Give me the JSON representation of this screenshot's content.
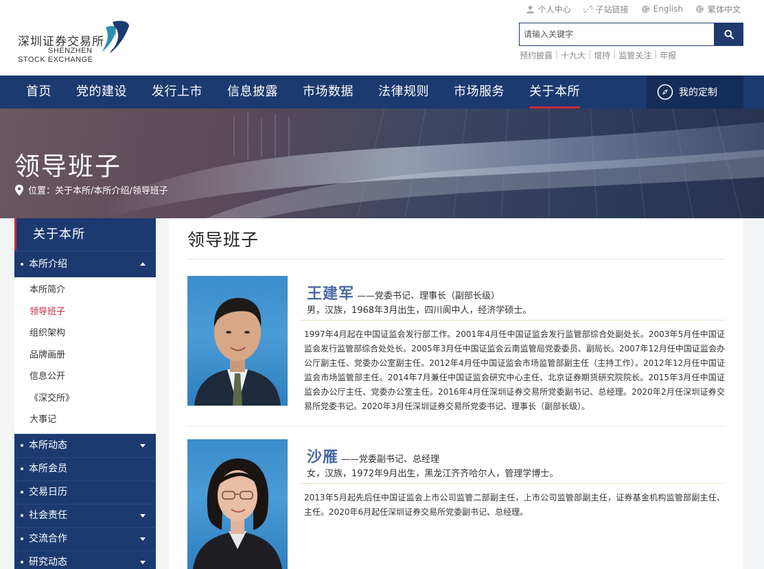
{
  "logo": {
    "cn": "深圳证券交易所",
    "en_line1": "SHENZHEN",
    "en_line2": "STOCK EXCHANGE",
    "colors": {
      "blue": "#1b3a70",
      "teal": "#2a8fb0"
    }
  },
  "toplinks": [
    {
      "icon": "person-icon",
      "label": "个人中心"
    },
    {
      "icon": "link-icon",
      "label": "子站链接"
    },
    {
      "icon": "globe-icon",
      "label": "English"
    },
    {
      "icon": "globe-icon",
      "label": "繁体中文"
    }
  ],
  "search": {
    "placeholder": "请输入关键字",
    "value": ""
  },
  "hotwords": [
    "预约披露",
    "十九大",
    "增持",
    "监管关注",
    "年报"
  ],
  "nav": {
    "items": [
      "首页",
      "党的建设",
      "发行上市",
      "信息披露",
      "市场数据",
      "法律规则",
      "市场服务",
      "关于本所"
    ],
    "active_index": 7,
    "custom_label": "我的定制"
  },
  "banner": {
    "title": "领导班子",
    "breadcrumb": "位置：关于本所/本所介绍/领导班子"
  },
  "sidebar": {
    "header": "关于本所",
    "sections": [
      {
        "label": "本所介绍",
        "expanded": true,
        "items": [
          "本所简介",
          "领导班子",
          "组织架构",
          "品牌画册",
          "信息公开",
          "《深交所》",
          "大事记"
        ],
        "active_item": "领导班子"
      },
      {
        "label": "本所动态",
        "has_children": true
      },
      {
        "label": "本所会员",
        "has_children": false
      },
      {
        "label": "交易日历",
        "has_children": false
      },
      {
        "label": "社会责任",
        "has_children": true
      },
      {
        "label": "交流合作",
        "has_children": true
      },
      {
        "label": "研究动态",
        "has_children": true
      }
    ]
  },
  "content": {
    "title": "领导班子",
    "people": [
      {
        "name": "王建军",
        "role": "——党委书记、理事长（副部长级）",
        "basic": "男，汉族，1968年3月出生，四川阆中人，经济学硕士。",
        "bio": "1997年4月起在中国证监会发行部工作。2001年4月任中国证监会发行监管部综合处副处长。2003年5月任中国证监会发行监管部综合处处长。2005年3月任中国证监会云南监管局党委委员、副局长。2007年12月任中国证监会办公厅副主任、党委办公室副主任。2012年4月任中国证监会市场监管部副主任（主持工作）。2012年12月任中国证监会市场监管部主任。2014年7月兼任中国证监会研究中心主任、北京证券期货研究院院长。2015年3月任中国证监会办公厅主任、党委办公室主任。2016年4月任深圳证券交易所党委副书记、总经理。2020年2月任深圳证券交易所党委书记。2020年3月任深圳证券交易所党委书记、理事长（副部长级）。"
      },
      {
        "name": "沙雁",
        "role": "——党委副书记、总经理",
        "basic": "女，汉族，1972年9月出生，黑龙江齐齐哈尔人，管理学博士。",
        "bio": "2013年5月起先后任中国证监会上市公司监管二部副主任，上市公司监管部副主任，证券基金机构监管部副主任、主任。2020年6月起任深圳证券交易所党委副书记、总经理。"
      }
    ]
  },
  "colors": {
    "nav_bg": "#1b3a70",
    "accent_red": "#c8283c",
    "name_blue": "#4a6aa0"
  }
}
